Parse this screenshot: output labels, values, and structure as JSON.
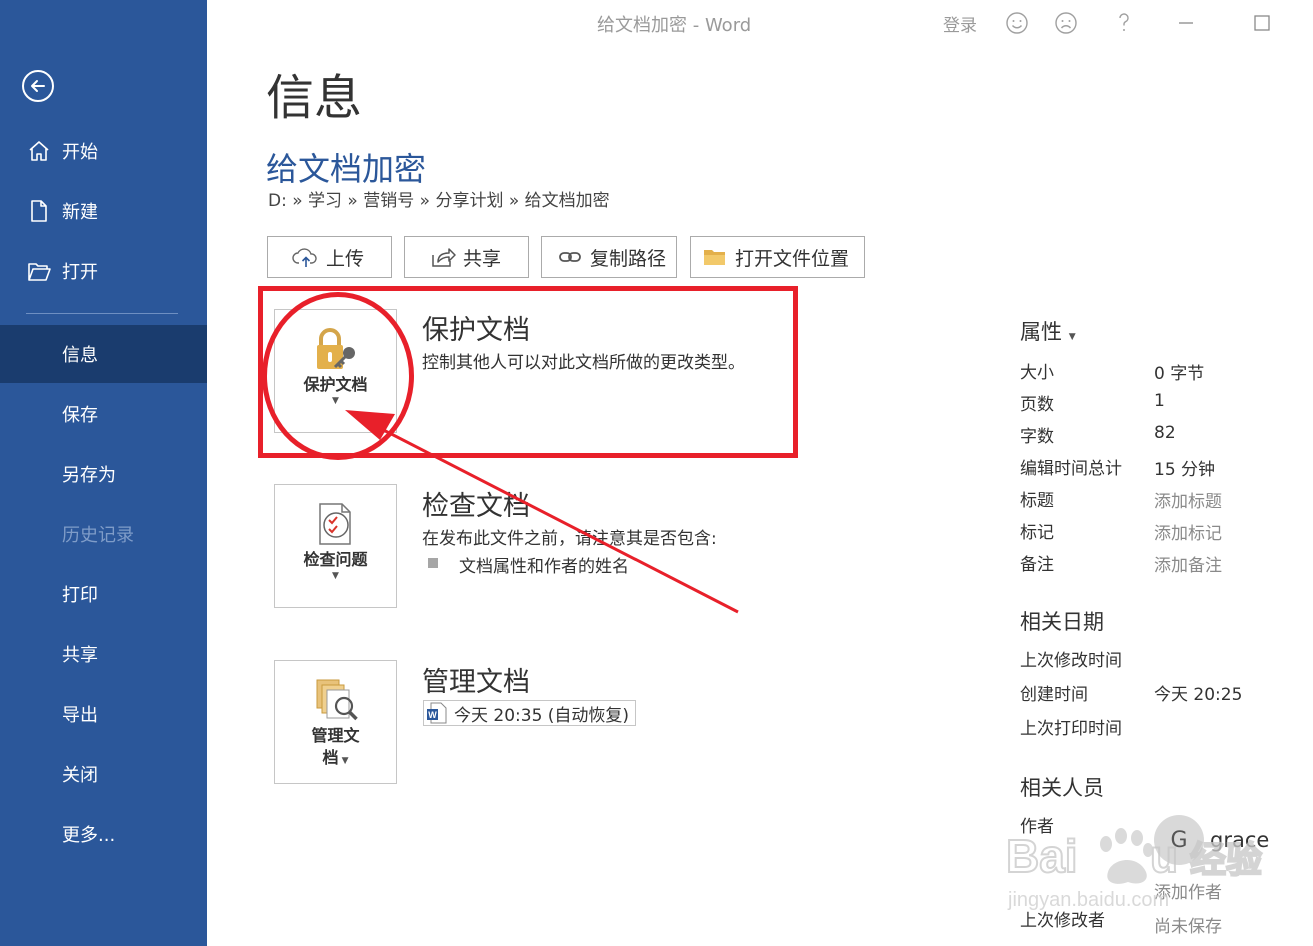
{
  "window": {
    "title": "给文档加密  -  Word",
    "login": "登录"
  },
  "sidebar": {
    "items": [
      {
        "label": "开始",
        "icon": "home-icon"
      },
      {
        "label": "新建",
        "icon": "new-document-icon"
      },
      {
        "label": "打开",
        "icon": "open-folder-icon"
      },
      {
        "label": "信息"
      },
      {
        "label": "保存"
      },
      {
        "label": "另存为"
      },
      {
        "label": "历史记录"
      },
      {
        "label": "打印"
      },
      {
        "label": "共享"
      },
      {
        "label": "导出"
      },
      {
        "label": "关闭"
      },
      {
        "label": "更多..."
      }
    ],
    "accent": "#2b579a",
    "active_bg": "#1a3c6e"
  },
  "main": {
    "page_title": "信息",
    "doc_title": "给文档加密",
    "breadcrumb": "D: » 学习 » 营销号 » 分享计划 » 给文档加密",
    "actions": [
      {
        "label": "上传",
        "icon": "cloud-upload-icon"
      },
      {
        "label": "共享",
        "icon": "share-icon"
      },
      {
        "label": "复制路径",
        "icon": "link-icon"
      },
      {
        "label": "打开文件位置",
        "icon": "folder-icon"
      }
    ],
    "protect": {
      "button_label": "保护文档",
      "title": "保护文档",
      "desc": "控制其他人可以对此文档所做的更改类型。"
    },
    "inspect": {
      "button_label": "检查问题",
      "title": "检查文档",
      "desc": "在发布此文件之前，请注意其是否包含:",
      "bullet": "文档属性和作者的姓名"
    },
    "manage": {
      "button_label_1": "管理文",
      "button_label_2": "档",
      "title": "管理文档",
      "version": "今天 20:35 (自动恢复)"
    }
  },
  "properties": {
    "heading": "属性",
    "rows": [
      {
        "label": "大小",
        "value": "0 字节"
      },
      {
        "label": "页数",
        "value": "1"
      },
      {
        "label": "字数",
        "value": "82"
      },
      {
        "label": "编辑时间总计",
        "value": "15 分钟"
      },
      {
        "label": "标题",
        "value": "添加标题"
      },
      {
        "label": "标记",
        "value": "添加标记"
      },
      {
        "label": "备注",
        "value": "添加备注"
      }
    ],
    "dates_heading": "相关日期",
    "dates": [
      {
        "label": "上次修改时间",
        "value": ""
      },
      {
        "label": "创建时间",
        "value": "今天 20:25"
      },
      {
        "label": "上次打印时间",
        "value": ""
      }
    ],
    "people_heading": "相关人员",
    "author_label": "作者",
    "author_initial": "G",
    "author_name": "grace",
    "add_author": "添加作者",
    "last_modified_by_label": "上次修改者",
    "last_modified_by_value": "尚未保存"
  },
  "watermark": {
    "brand": "Baidu",
    "brand_cn": "经验",
    "url": "jingyan.baidu.com"
  }
}
